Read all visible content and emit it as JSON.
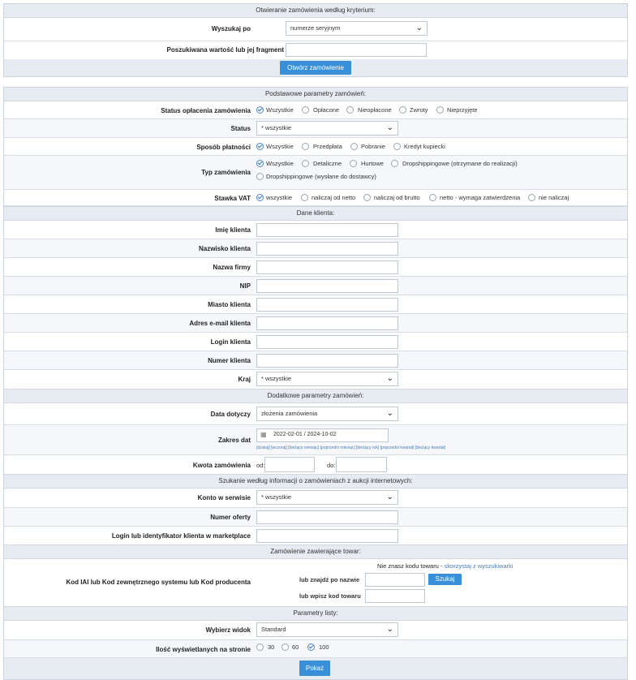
{
  "open_order": {
    "title": "Otwieranie zamówienia według kryterium:",
    "search_by_label": "Wyszukaj po",
    "search_by_value": "numerze seryjnym",
    "search_value_label": "Poszukiwana wartość lub jej fragment",
    "open_button": "Otwórz zamówienie"
  },
  "basic": {
    "title": "Podstawowe parametry zamówień:",
    "payment_status_label": "Status opłacenia zamówienia",
    "payment_status_options": [
      "Wszystkie",
      "Opłacone",
      "Nieopłacone",
      "Zwroty",
      "Nieprzyjęte"
    ],
    "status_label": "Status",
    "status_value": "* wszystkie",
    "payment_method_label": "Sposób płatności",
    "payment_method_options": [
      "Wszystkie",
      "Przedpłata",
      "Pobranie",
      "Kredyt kupiecki"
    ],
    "order_type_label": "Typ zamówienia",
    "order_type_options": [
      "Wszystkie",
      "Detaliczne",
      "Hurtowe",
      "Dropshippingowe (otrzymane do realizacji)",
      "Dropshippingowe (wysłane do dostawcy)"
    ],
    "vat_label": "Stawka VAT",
    "vat_options": [
      "wszystkie",
      "naliczaj od netto",
      "naliczaj od brutto",
      "netto - wymaga zatwierdzenia",
      "nie naliczaj"
    ]
  },
  "client": {
    "title": "Dane klienta:",
    "fields": [
      "Imię klienta",
      "Nazwisko klienta",
      "Nazwa firmy",
      "NIP",
      "Miasto klienta",
      "Adres e-mail klienta",
      "Login klienta",
      "Numer klienta"
    ],
    "country_label": "Kraj",
    "country_value": "* wszystkie"
  },
  "additional": {
    "title": "Dodatkowe parametry zamówień:",
    "date_concerns_label": "Data dotyczy",
    "date_concerns_value": "złożenia zamówienia",
    "date_range_label": "Zakres dat",
    "date_range_value": "2022-02-01 / 2024-10-02",
    "quick_ranges": [
      "[dzisiaj]",
      "[wczoraj]",
      "[bieżący miesiąc]",
      "[poprzedni miesiąc]",
      "[bieżący rok]",
      "[poprzedni kwartał]",
      "[bieżący kwartał]"
    ],
    "amount_label": "Kwota zamówienia",
    "amount_from": "od:",
    "amount_to": "do:"
  },
  "auction": {
    "title": "Szukanie według informacji o zamówieniach z aukcji internetowych:",
    "account_label": "Konto w serwisie",
    "account_value": "* wszystkie",
    "offer_label": "Numer oferty",
    "login_label": "Login lub identyfikator klienta w marketplace"
  },
  "product": {
    "title": "Zamówienie zawierające towar:",
    "code_label": "Kod IAI lub Kod zewnętrznego systemu lub Kod producenta",
    "hint_text": "Nie znasz kodu towaru -",
    "hint_link": "skorzystaj z wyszukiwarki",
    "find_by_name_label": "lub znajdź po nazwie",
    "search_button": "Szukaj",
    "enter_code_label": "lub wpisz kod towaru"
  },
  "list": {
    "title": "Parametry listy:",
    "view_label": "Wybierz widok",
    "view_value": "Standard",
    "per_page_label": "Ilość wyświetlanych na stronie",
    "per_page_options": [
      "30",
      "60",
      "100"
    ],
    "show_button": "Pokaż"
  }
}
